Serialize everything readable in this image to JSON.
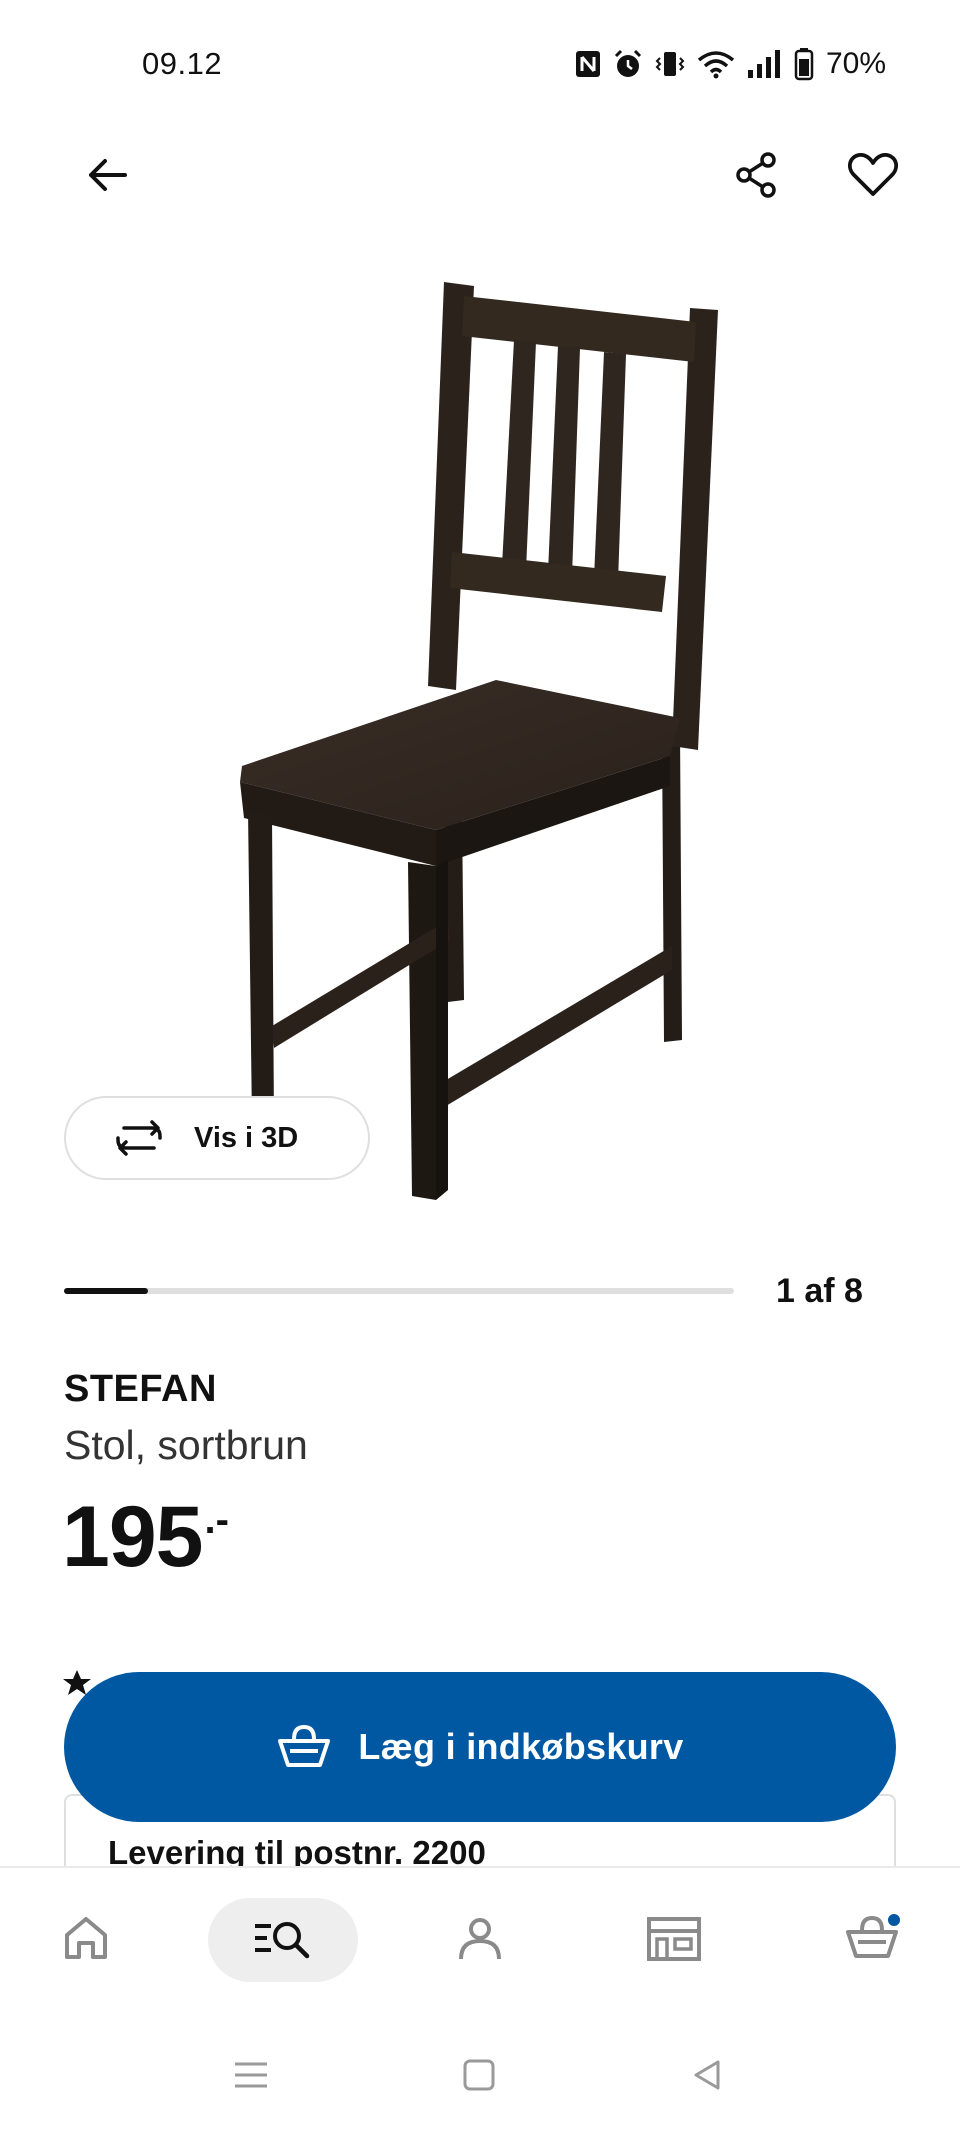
{
  "status_bar": {
    "time": "09.12",
    "battery_percent": "70%",
    "icons": [
      "nfc-icon",
      "alarm-icon",
      "vibrate-icon",
      "wifi-icon",
      "signal-icon",
      "battery-icon"
    ]
  },
  "top_nav": {
    "icons": [
      "back-arrow-icon",
      "share-icon",
      "heart-icon"
    ]
  },
  "gallery": {
    "view_3d_label": "Vis i 3D",
    "page_counter": "1 af 8",
    "current_image": 1,
    "total_images": 8
  },
  "product": {
    "name": "STEFAN",
    "description": "Stol, sortbrun",
    "price": "195",
    "price_suffix": ".-"
  },
  "actions": {
    "add_to_cart_label": "Læg i indkøbskurv"
  },
  "delivery": {
    "text": "Levering til postnr. 2200"
  },
  "bottom_nav": {
    "items": [
      "home-icon",
      "search-icon",
      "profile-icon",
      "store-icon",
      "cart-icon"
    ],
    "active": "search-icon",
    "cart_badge": true
  },
  "colors": {
    "primary_blue": "#0058a3",
    "text": "#111111",
    "chair_wood": "#2e241d",
    "divider": "#dfdfdf"
  }
}
